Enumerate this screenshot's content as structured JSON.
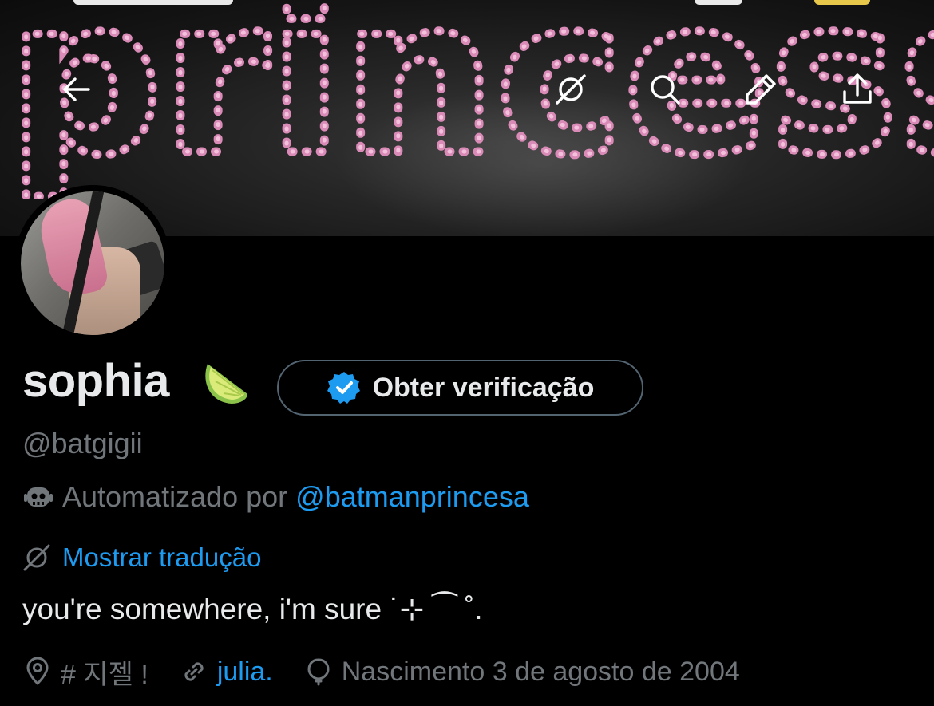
{
  "banner": {
    "word": "princess"
  },
  "topbar": {
    "back_icon": "arrow-left-icon",
    "translate_icon": "translate-icon",
    "search_icon": "search-icon",
    "edit_icon": "pencil-icon",
    "share_icon": "share-icon"
  },
  "profile": {
    "display_name": "sophia",
    "name_emoji": "lime-icon",
    "verify_button_label": "Obter verificação",
    "handle": "@batgigii",
    "automated_prefix": "Automatizado por",
    "automated_by": "@batmanprincesa",
    "translate_label": "Mostrar tradução",
    "bio": "you're somewhere, i'm sure ˙⊹ ⁀ ˚.",
    "location": "# 지젤 !",
    "website": "julia.",
    "birth": "Nascimento 3 de agosto de 2004"
  },
  "colors": {
    "background": "#000000",
    "text_primary": "#e7e9ea",
    "text_secondary": "#71767b",
    "accent_blue": "#1d9bf0",
    "banner_pink": "#d98ab7",
    "button_border": "#536471"
  }
}
